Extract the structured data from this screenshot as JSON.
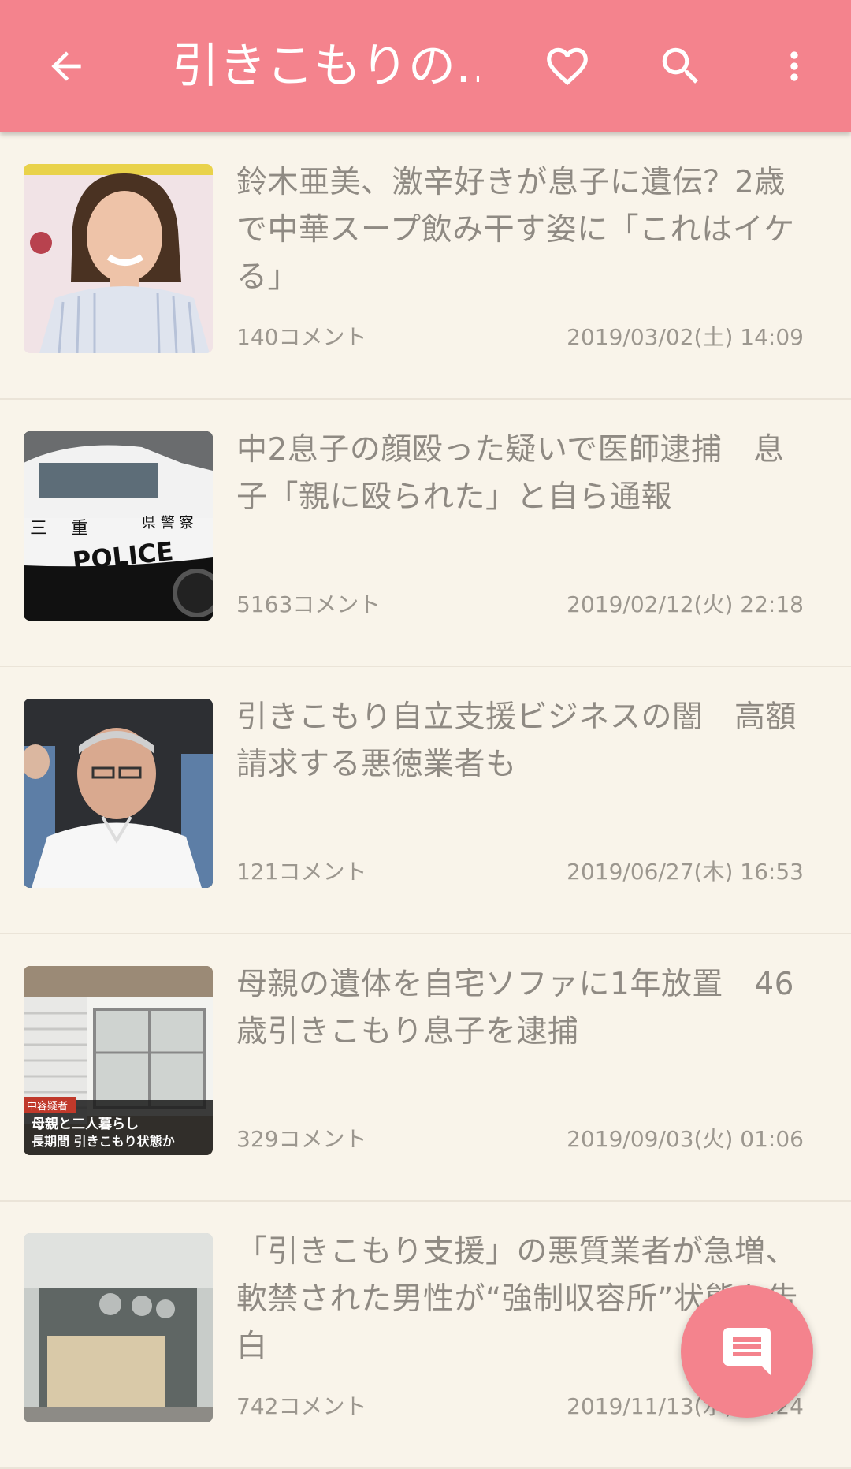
{
  "appbar": {
    "title": "引きこもりの…",
    "icons": [
      "back-arrow-icon",
      "heart-icon",
      "search-icon",
      "more-vert-icon"
    ]
  },
  "articles": [
    {
      "title": "鈴木亜美、激辛好きが息子に遺伝？2歳で中華スープ飲み干す姿に「これはイケる」",
      "comments": "140コメント",
      "date": "2019/03/02(土) 14:09"
    },
    {
      "title": "中2息子の顔殴った疑いで医師逮捕　息子「親に殴られた」と自ら通報",
      "comments": "5163コメント",
      "date": "2019/02/12(火) 22:18",
      "thumb_text": {
        "a": "三",
        "b": "重",
        "c": "県 警 察",
        "d": "POLICE"
      }
    },
    {
      "title": "引きこもり自立支援ビジネスの闇　高額請求する悪徳業者も",
      "comments": "121コメント",
      "date": "2019/06/27(木) 16:53"
    },
    {
      "title": "母親の遺体を自宅ソファに1年放置　46歳引きこもり息子を逮捕",
      "comments": "329コメント",
      "date": "2019/09/03(火) 01:06",
      "thumb_text": {
        "tag": "中容疑者",
        "line1": "母親と二人暮らし",
        "line2": "長期間 引きこもり状態か"
      }
    },
    {
      "title": "「引きこもり支援」の悪質業者が急増、軟禁された男性が“強制収容所”状態を告白",
      "comments": "742コメント",
      "date": "2019/11/13(水) 10:24"
    }
  ],
  "fab": {
    "icon": "comment-icon"
  },
  "colors": {
    "accent": "#f4838d",
    "background": "#f9f4ea",
    "text": "#8f8a83"
  }
}
